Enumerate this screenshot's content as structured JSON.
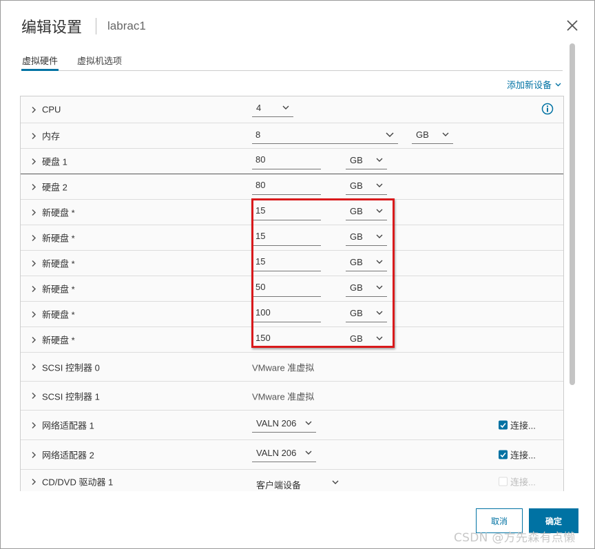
{
  "dialog": {
    "title": "编辑设置",
    "vm_name": "labrac1"
  },
  "tabs": [
    {
      "label": "虚拟硬件",
      "active": true
    },
    {
      "label": "虚拟机选项",
      "active": false
    }
  ],
  "add_device": "添加新设备",
  "rows": {
    "cpu": {
      "label": "CPU",
      "value": "4"
    },
    "memory": {
      "label": "内存",
      "value": "8",
      "unit": "GB"
    },
    "disk1": {
      "label": "硬盘 1",
      "value": "80",
      "unit": "GB"
    },
    "disk2": {
      "label": "硬盘 2",
      "value": "80",
      "unit": "GB"
    },
    "new_disks": [
      {
        "label": "新硬盘 *",
        "value": "15",
        "unit": "GB"
      },
      {
        "label": "新硬盘 *",
        "value": "15",
        "unit": "GB"
      },
      {
        "label": "新硬盘 *",
        "value": "15",
        "unit": "GB"
      },
      {
        "label": "新硬盘 *",
        "value": "50",
        "unit": "GB"
      },
      {
        "label": "新硬盘 *",
        "value": "100",
        "unit": "GB"
      },
      {
        "label": "新硬盘 *",
        "value": "150",
        "unit": "GB"
      }
    ],
    "scsi0": {
      "label": "SCSI 控制器 0",
      "value": "VMware 准虚拟"
    },
    "scsi1": {
      "label": "SCSI 控制器 1",
      "value": "VMware 准虚拟"
    },
    "net1": {
      "label": "网络适配器 1",
      "value": "VALN 206",
      "connect": "连接...",
      "checked": true
    },
    "net2": {
      "label": "网络适配器 2",
      "value": "VALN 206",
      "connect": "连接...",
      "checked": true
    },
    "cdrom": {
      "label": "CD/DVD 驱动器 1",
      "value": "客户端设备",
      "connect": "连接...",
      "checked": false
    }
  },
  "buttons": {
    "cancel": "取消",
    "ok": "确定"
  },
  "watermark": "CSDN @方先森有点懒",
  "colors": {
    "accent": "#0072a3",
    "highlight": "#d9191b"
  }
}
